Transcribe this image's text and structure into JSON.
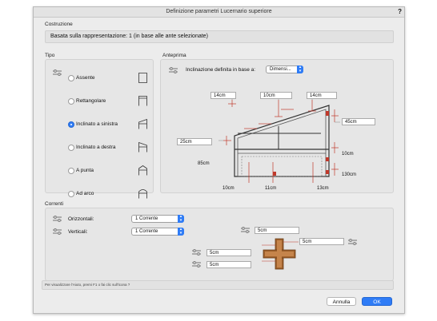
{
  "dialog": {
    "title": "Definizione parametri Lucernario superiore",
    "help": "?"
  },
  "costruzione": {
    "section": "Costruzione",
    "base_text": "Basata sulla rappresentazione: 1 (in base alle ante selezionate)"
  },
  "tipo": {
    "section": "Tipo",
    "options": [
      {
        "label": "Assente",
        "selected": false
      },
      {
        "label": "Rettangolare",
        "selected": false
      },
      {
        "label": "Inclinato a sinistra",
        "selected": true
      },
      {
        "label": "Inclinato a destra",
        "selected": false
      },
      {
        "label": "A punta",
        "selected": false
      },
      {
        "label": "Ad arco",
        "selected": false
      }
    ]
  },
  "anteprima": {
    "section": "Anteprima",
    "inclination_label": "Inclinazione definita in base a:",
    "inclination_value": "Dimensi...",
    "dims": {
      "top_left": "14cm",
      "top_mid": "10cm",
      "top_right": "14cm",
      "left": "25cm",
      "right": "45cm",
      "height_label": "85cm",
      "right_low": "10cm",
      "right_total": "130cm",
      "bottom_left": "10cm",
      "bottom_mid": "11cm",
      "bottom_right": "13cm"
    }
  },
  "correnti": {
    "section": "Correnti",
    "horizontal_label": "Orizzontali:",
    "horizontal_value": "1 Corrente",
    "vertical_label": "Verticali:",
    "vertical_value": "1 Corrente",
    "cross": {
      "top": "5cm",
      "right": "5cm",
      "left_top": "5cm",
      "left_bottom": "5cm"
    }
  },
  "footer": {
    "hint": "Per visualizzare l'Aiuto, premi F1 o fai clic sull'icona ?",
    "cancel": "Annulla",
    "ok": "OK"
  },
  "colors": {
    "accent": "#2f7cf6",
    "preview_red": "#c0392b",
    "mullion": "#a0622d"
  }
}
